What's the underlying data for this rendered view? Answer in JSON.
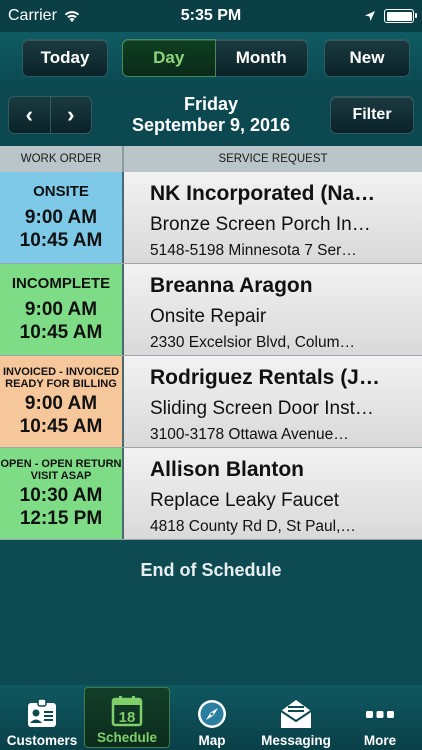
{
  "status_bar": {
    "carrier": "Carrier",
    "time": "5:35 PM"
  },
  "toolbar": {
    "today_label": "Today",
    "day_label": "Day",
    "month_label": "Month",
    "new_label": "New",
    "active_tab": "Day"
  },
  "date_bar": {
    "prev_glyph": "‹",
    "next_glyph": "›",
    "weekday": "Friday",
    "date": "September 9, 2016",
    "filter_label": "Filter"
  },
  "columns": {
    "work_order": "WORK ORDER",
    "service_request": "SERVICE REQUEST"
  },
  "rows": [
    {
      "status": "ONSITE",
      "start": "9:00 AM",
      "end": "10:45 AM",
      "status_color": "#7ec8e8",
      "customer": "NK Incorporated (Na…",
      "service": "Bronze Screen Porch In…",
      "address": "5148-5198 Minnesota 7 Ser…"
    },
    {
      "status": "INCOMPLETE",
      "start": "9:00 AM",
      "end": "10:45 AM",
      "status_color": "#7fdc86",
      "customer": "Breanna Aragon",
      "service": "Onsite Repair",
      "address": "2330 Excelsior Blvd, Colum…"
    },
    {
      "status": "INVOICED - INVOICED  READY FOR BILLING",
      "start": "9:00 AM",
      "end": "10:45 AM",
      "status_color": "#f6c79a",
      "customer": "Rodriguez Rentals (J…",
      "service": "Sliding Screen Door Inst…",
      "address": "3100-3178 Ottawa Avenue…"
    },
    {
      "status": "OPEN - OPEN RETURN VISIT ASAP",
      "start": "10:30 AM",
      "end": "12:15 PM",
      "status_color": "#7fdc86",
      "customer": "Allison Blanton",
      "service": "Replace Leaky Faucet",
      "address": "4818 County Rd D, St Paul,…"
    }
  ],
  "end_label": "End of Schedule",
  "tabs": [
    {
      "label": "Customers",
      "icon": "customers-icon"
    },
    {
      "label": "Schedule",
      "icon": "calendar-icon",
      "badge": "18"
    },
    {
      "label": "Map",
      "icon": "compass-icon"
    },
    {
      "label": "Messaging",
      "icon": "envelope-icon"
    },
    {
      "label": "More",
      "icon": "more-dots-icon"
    }
  ],
  "active_tab": "Schedule"
}
